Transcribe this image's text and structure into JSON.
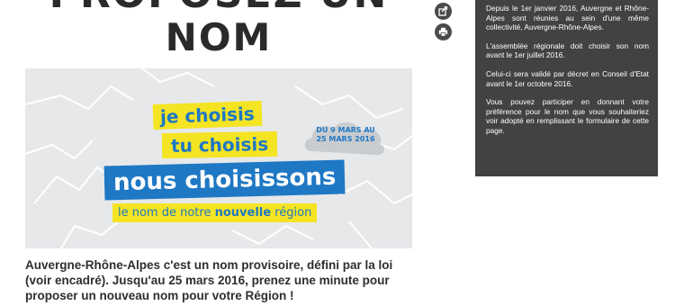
{
  "header": {
    "title_top": "PROPOSEZ UN",
    "title_main": "NOM"
  },
  "actions": {
    "share_icon": "share-icon",
    "print_icon": "print-icon"
  },
  "banner": {
    "line1": "je choisis",
    "line2": "tu choisis",
    "line3": "nous choisissons",
    "line4_prefix": "le nom de notre ",
    "line4_bold": "nouvelle",
    "line4_suffix": " région",
    "date_line1": "DU 9 MARS AU",
    "date_line2": "25 MARS 2016",
    "colors": {
      "yellow": "#f4e423",
      "blue": "#1f78c4",
      "background": "#e7e8ea"
    }
  },
  "intro": {
    "text": "Auvergne-Rhône-Alpes c'est un nom provisoire, défini par la loi (voir encadré). Jusqu'au 25 mars 2016, prenez une minute pour proposer un nouveau nom pour votre Région !"
  },
  "sidebar": {
    "paragraphs": [
      "Depuis le 1er janvier 2016, Auvergne et Rhône-Alpes sont réunies au sein d'une même collectivité, Auvergne-Rhône-Alpes.",
      "L'assemblée régionale doit choisir son nom avant le 1er juillet 2016.",
      "Celui-ci sera validé par décret en Conseil d'Etat avant le 1er octobre 2016.",
      "Vous pouvez participer en donnant votre préférence pour le nom que vous souhaiteriez voir adopté en remplissant le formulaire de cette page."
    ],
    "background": "#424242"
  }
}
